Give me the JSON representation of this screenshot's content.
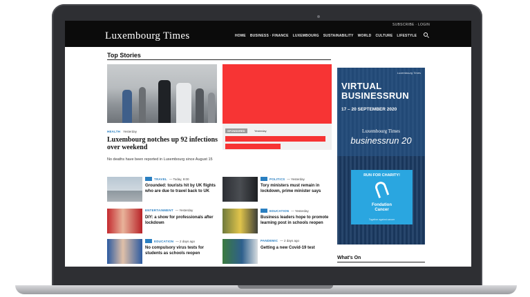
{
  "site": {
    "logo": "Luxembourg Times",
    "top_link": "SUBSCRIBE · LOGIN",
    "nav": [
      "HOME",
      "BUSINESS · FINANCE",
      "LUXEMBOURG",
      "SUSTAINABILITY",
      "WORLD",
      "CULTURE",
      "LIFESTYLE"
    ]
  },
  "main": {
    "section_title": "Top Stories",
    "lead": {
      "category": "HEALTH",
      "date": "Yesterday",
      "headline": "Luxembourg notches up 92 infections over weekend",
      "summary": "No deaths have been reported in Luxembourg since August 15"
    },
    "ad_card": {
      "label": "SPONSORED",
      "date": "Yesterday"
    },
    "stories": [
      {
        "category": "TRAVEL",
        "date": "— Today, 9:00",
        "headline": "Grounded: tourists hit by UK flights who are due to travel back to UK"
      },
      {
        "category": "POLITICS",
        "date": "— Yesterday",
        "headline": "Tory ministers must remain in lockdown, prime minister says"
      },
      {
        "category": "ENTERTAINMENT",
        "date": "— Yesterday",
        "headline": "DIY: a show for professionals after lockdown"
      },
      {
        "category": "EDUCATION",
        "date": "— Yesterday",
        "headline": "Business leaders hope to promote learning post in schools reopen"
      },
      {
        "category": "EDUCATION",
        "date": "— 2 days ago",
        "headline": "No compulsory virus tests for students as schools reopen"
      },
      {
        "category": "PANDEMIC",
        "date": "— 2 days ago",
        "headline": "Getting a new Covid-19 test"
      }
    ]
  },
  "banner": {
    "small_logo": "Luxembourg Times",
    "title_line1": "VIRTUAL",
    "title_line2": "BUSINESSRUN",
    "dates": "17 – 20 SEPTEMBER 2020",
    "lt_text": "Luxembourg Times",
    "br_text": "businessrun 20",
    "charity_title": "RUN FOR CHARITY!",
    "charity_org_line1": "Fondation",
    "charity_org_line2": "Cancer",
    "charity_foot": "Together against cancer"
  },
  "sidebar": {
    "whats_on": "What's On"
  },
  "colors": {
    "accent": "#2a7fc1",
    "ad_red": "#f73434",
    "topbar": "#0b0b0b",
    "banner_blue": "#1b3b63",
    "charity_blue": "#2aa6e0"
  }
}
